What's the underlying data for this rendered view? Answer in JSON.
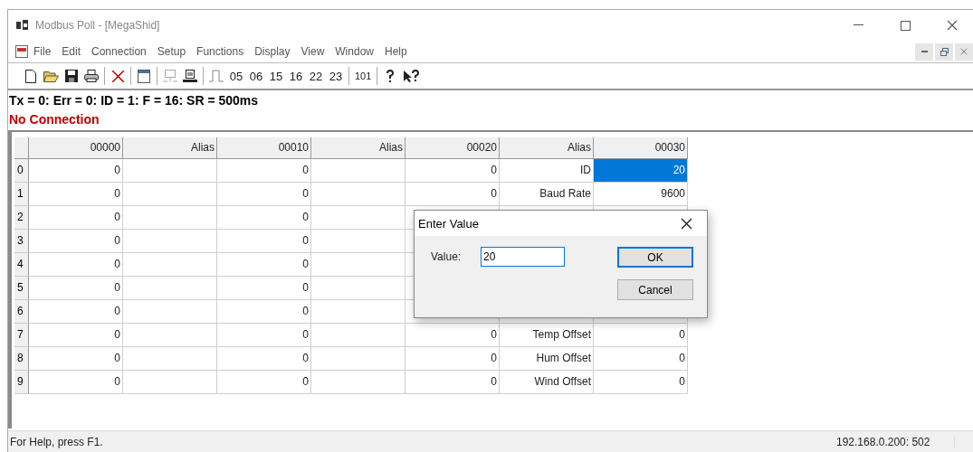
{
  "window": {
    "title": "Modbus Poll - [MegaShid]"
  },
  "menu": [
    "File",
    "Edit",
    "Connection",
    "Setup",
    "Functions",
    "Display",
    "View",
    "Window",
    "Help"
  ],
  "toolbar": {
    "function_codes": [
      "05",
      "06",
      "15",
      "16",
      "22",
      "23"
    ],
    "count_label": "101"
  },
  "info_line": "Tx = 0: Err = 0: ID = 1: F = 16: SR = 500ms",
  "connection_status": "No Connection",
  "table": {
    "columns": [
      "00000",
      "Alias",
      "00010",
      "Alias",
      "00020",
      "Alias",
      "00030"
    ],
    "rows": [
      {
        "header": "0",
        "cells": [
          {
            "text": "0",
            "selected": false
          },
          {
            "selected": false
          },
          {
            "text": "0",
            "selected": false
          },
          {
            "selected": false
          },
          {
            "text": "0",
            "selected": false
          },
          {
            "text": "ID",
            "selected": false
          },
          {
            "text": "20",
            "selected": true
          }
        ]
      },
      {
        "header": "1",
        "cells": [
          {
            "text": "0",
            "selected": false
          },
          {
            "selected": false
          },
          {
            "text": "0",
            "selected": false
          },
          {
            "selected": false
          },
          {
            "text": "0",
            "selected": false
          },
          {
            "text": "Baud Rate",
            "selected": false
          },
          {
            "text": "9600",
            "selected": false
          }
        ]
      },
      {
        "header": "2",
        "cells": [
          {
            "text": "0",
            "selected": false
          },
          {
            "selected": false
          },
          {
            "text": "0",
            "selected": false
          },
          {
            "selected": false
          },
          null,
          null,
          null
        ]
      },
      {
        "header": "3",
        "cells": [
          {
            "text": "0",
            "selected": false
          },
          {
            "selected": false
          },
          {
            "text": "0",
            "selected": false
          },
          {
            "selected": false
          },
          null,
          null,
          null
        ]
      },
      {
        "header": "4",
        "cells": [
          {
            "text": "0",
            "selected": false
          },
          {
            "selected": false
          },
          {
            "text": "0",
            "selected": false
          },
          {
            "selected": false
          },
          null,
          null,
          null
        ]
      },
      {
        "header": "5",
        "cells": [
          {
            "text": "0",
            "selected": false
          },
          {
            "selected": false
          },
          {
            "text": "0",
            "selected": false
          },
          {
            "selected": false
          },
          null,
          null,
          null
        ]
      },
      {
        "header": "6",
        "cells": [
          {
            "text": "0",
            "selected": false
          },
          {
            "selected": false
          },
          {
            "text": "0",
            "selected": false
          },
          {
            "selected": false
          },
          null,
          null,
          null
        ]
      },
      {
        "header": "7",
        "cells": [
          {
            "text": "0",
            "selected": false
          },
          {
            "selected": false
          },
          {
            "text": "0",
            "selected": false
          },
          {
            "selected": false
          },
          {
            "text": "0",
            "selected": false
          },
          {
            "text": "Temp Offset",
            "selected": false
          },
          {
            "text": "0",
            "selected": false
          }
        ]
      },
      {
        "header": "8",
        "cells": [
          {
            "text": "0",
            "selected": false
          },
          {
            "selected": false
          },
          {
            "text": "0",
            "selected": false
          },
          {
            "selected": false
          },
          {
            "text": "0",
            "selected": false
          },
          {
            "text": "Hum Offset",
            "selected": false
          },
          {
            "text": "0",
            "selected": false
          }
        ]
      },
      {
        "header": "9",
        "cells": [
          {
            "text": "0",
            "selected": false
          },
          {
            "selected": false
          },
          {
            "text": "0",
            "selected": false
          },
          {
            "selected": false
          },
          {
            "text": "0",
            "selected": false
          },
          {
            "text": "Wind Offset",
            "selected": false
          },
          {
            "text": "0",
            "selected": false
          }
        ]
      }
    ]
  },
  "dialog": {
    "title": "Enter Value",
    "label": "Value:",
    "value": "20",
    "buttons": [
      "OK",
      "Cancel"
    ]
  },
  "status_bar": {
    "help": "For Help, press F1.",
    "address": "192.168.0.200: 502"
  }
}
